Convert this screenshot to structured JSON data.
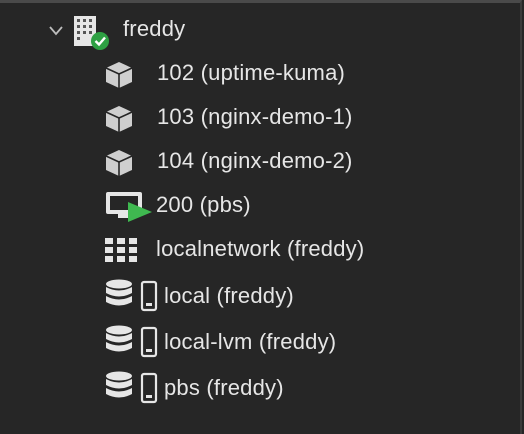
{
  "tree": {
    "node": {
      "label": "freddy",
      "icon": "server-node-online-icon",
      "expanded": true
    },
    "children": [
      {
        "label": "102 (uptime-kuma)",
        "icon": "container-icon"
      },
      {
        "label": "103 (nginx-demo-1)",
        "icon": "container-icon"
      },
      {
        "label": "104 (nginx-demo-2)",
        "icon": "container-icon"
      },
      {
        "label": "200 (pbs)",
        "icon": "vm-running-icon"
      },
      {
        "label": "localnetwork (freddy)",
        "icon": "network-grid-icon"
      },
      {
        "label": "local (freddy)",
        "icon": "storage-icon"
      },
      {
        "label": "local-lvm (freddy)",
        "icon": "storage-icon"
      },
      {
        "label": "pbs (freddy)",
        "icon": "storage-icon"
      }
    ]
  },
  "colors": {
    "background": "#262626",
    "text": "#e6e6e6",
    "icon": "#d0d0d0",
    "status_green": "#2ea043",
    "run_green": "#3fb950"
  }
}
